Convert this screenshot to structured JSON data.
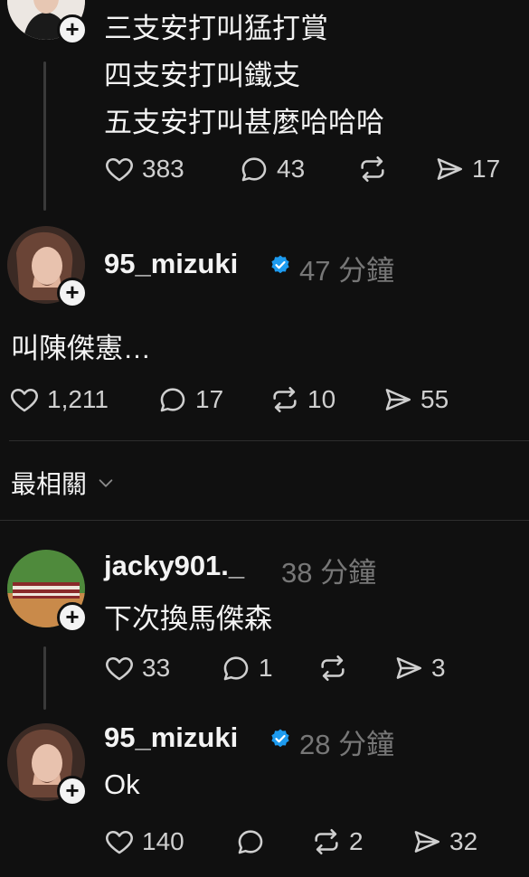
{
  "top_post": {
    "lines": [
      "三支安打叫猛打賞",
      "四支安打叫鐵支",
      "五支安打叫甚麼哈哈哈"
    ],
    "stats": {
      "likes": "383",
      "replies": "43",
      "reposts": "",
      "shares": "17"
    }
  },
  "reply1": {
    "username": "95_mizuki",
    "time": "47 分鐘",
    "text": "叫陳傑憲…",
    "stats": {
      "likes": "1,211",
      "replies": "17",
      "reposts": "10",
      "shares": "55"
    }
  },
  "sort": {
    "label": "最相關"
  },
  "reply2": {
    "username": "jacky901._",
    "time": "38 分鐘",
    "text": "下次換馬傑森",
    "stats": {
      "likes": "33",
      "replies": "1",
      "reposts": "",
      "shares": "3"
    }
  },
  "reply3": {
    "username": "95_mizuki",
    "time": "28 分鐘",
    "text": "Ok",
    "stats": {
      "likes": "140",
      "replies": "",
      "reposts": "2",
      "shares": "32"
    }
  },
  "colors": {
    "background": "#101010",
    "verified": "#1d9bf0",
    "muted": "#777777"
  }
}
